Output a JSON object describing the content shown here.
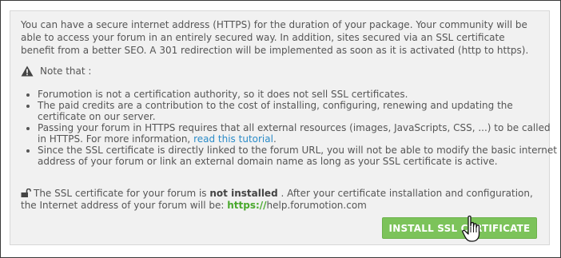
{
  "intro_text": "You can have a secure internet address (HTTPS) for the duration of your package. Your community will be able to access your forum in an entirely secured way. In addition, sites secured via an SSL certificate benefit from a better SEO. A 301 redirection will be implemented as soon as it is activated (http to https).",
  "note_label": "Note that :",
  "bullets": [
    {
      "text": "Forumotion is not a certification authority, so it does not sell SSL certificates."
    },
    {
      "text": "The paid credits are a contribution to the cost of installing, configuring, renewing and updating the certificate on our server."
    },
    {
      "text": "Passing your forum in HTTPS requires that all external resources (images, JavaScripts, CSS, ...) to be called in HTTPS. For more information,",
      "link": "read this tutorial",
      "after": "."
    },
    {
      "text": "Since the SSL certificate is directly linked to the forum URL, you will not be able to modify the basic internet address of your forum or link an external domain name as long as your SSL certificate is active."
    }
  ],
  "status": {
    "before": "The SSL certificate for your forum is",
    "state": "not installed",
    "after": ". After your certificate installation and configuration, the Internet address of your forum will be:",
    "https": "https://",
    "domain": "help.forumotion.com"
  },
  "install_button": "INSTALL SSL CERTIFICATE",
  "icons": {
    "note": "warning-icon",
    "status": "unlocked-padlock-icon",
    "cursor": "hand-pointer-icon"
  },
  "colors": {
    "panel_bg": "#f1f1f1",
    "button_bg": "#7cc35a",
    "link": "#2a8bc8",
    "https": "#49a82d"
  }
}
